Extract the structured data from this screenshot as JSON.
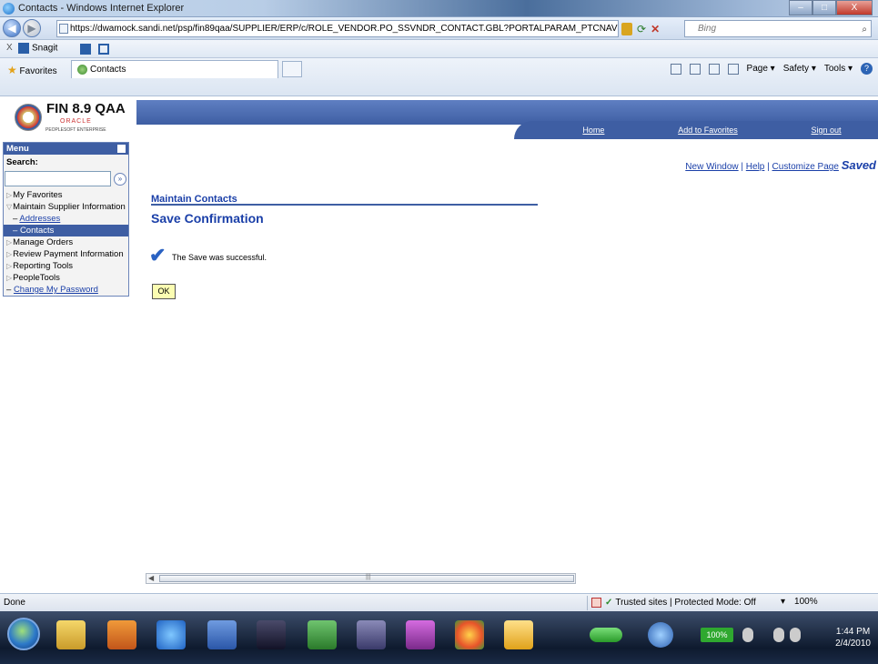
{
  "window": {
    "title": "Contacts - Windows Internet Explorer",
    "url": "https://dwamock.sandi.net/psp/fin89qaa/SUPPLIER/ERP/c/ROLE_VENDOR.PO_SSVNDR_CONTACT.GBL?PORTALPARAM_PTCNAV=EP_WV_C( ",
    "search_placeholder": "Bing",
    "buttons": {
      "minimize": "–",
      "maximize": "□",
      "close": "X"
    }
  },
  "toolbar": {
    "close_label": "X",
    "snagit_label": "Snagit"
  },
  "favbar": {
    "favorites_label": "Favorites",
    "tab_label": "Contacts",
    "page_menu": "Page ▾",
    "safety_menu": "Safety ▾",
    "tools_menu": "Tools ▾",
    "help_icon": "?"
  },
  "logo": {
    "title": "FIN 8.9 QAA",
    "oracle": "ORACLE",
    "ps": "PEOPLESOFT ENTERPRISE"
  },
  "banner": {
    "links": [
      "Home",
      "Add to Favorites",
      "Sign out"
    ]
  },
  "menu": {
    "header": "Menu",
    "search_label": "Search:",
    "search_go": "»",
    "items": [
      {
        "label": "My Favorites"
      },
      {
        "label": "Maintain Supplier Information"
      },
      {
        "label": "Addresses"
      },
      {
        "label": "Contacts"
      },
      {
        "label": "Manage Orders"
      },
      {
        "label": "Review Payment Information"
      },
      {
        "label": "Reporting Tools"
      },
      {
        "label": "PeopleTools"
      },
      {
        "label": "Change My Password"
      }
    ]
  },
  "pagelinks": {
    "new_window": "New Window",
    "help": "Help",
    "customize": "Customize Page",
    "saved": "Saved"
  },
  "main": {
    "breadcrumb": "Maintain Contacts",
    "title": "Save Confirmation",
    "message": "The Save was successful.",
    "ok_label": "OK"
  },
  "statusbar": {
    "status": "Done",
    "zone": "Trusted sites | Protected Mode: Off",
    "zoom": "100%"
  },
  "taskbar": {
    "battery": "100%",
    "time": "1:44 PM",
    "date": "2/4/2010"
  }
}
